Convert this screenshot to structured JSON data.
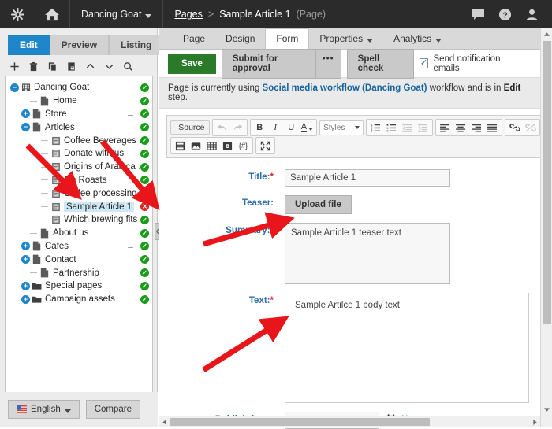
{
  "topbar": {
    "logo_icon": "kentico-asterisk-icon",
    "home_icon": "home-icon",
    "site_name": "Dancing Goat",
    "breadcrumb": {
      "root": "Pages",
      "separator": ">",
      "current": "Sample Article 1",
      "type": "(Page)"
    },
    "right_icons": [
      "chat-icon",
      "help-icon",
      "user-icon"
    ]
  },
  "sidebar": {
    "tabs": [
      {
        "label": "Edit",
        "active": true
      },
      {
        "label": "Preview",
        "active": false
      },
      {
        "label": "Listing",
        "active": false
      }
    ],
    "toolbar": [
      {
        "name": "new-page-button",
        "glyph": "+"
      },
      {
        "name": "delete-page-button",
        "glyph": "trash"
      },
      {
        "name": "copy-page-button",
        "glyph": "copy"
      },
      {
        "name": "paste-page-button",
        "glyph": "paste"
      },
      {
        "name": "move-up-button",
        "glyph": "chevron-up"
      },
      {
        "name": "move-down-button",
        "glyph": "chevron-down"
      },
      {
        "name": "search-button",
        "glyph": "search"
      }
    ],
    "tree": [
      {
        "label": "Dancing Goat",
        "indent": 0,
        "expander": "minus",
        "icon": "site-icon",
        "status": "ok",
        "arrow": false,
        "selected": false
      },
      {
        "label": "Home",
        "indent": 1,
        "expander": "none",
        "icon": "page-icon",
        "status": "ok",
        "arrow": false,
        "selected": false
      },
      {
        "label": "Store",
        "indent": 1,
        "expander": "plus",
        "icon": "page-icon",
        "status": "ok",
        "arrow": true,
        "selected": false
      },
      {
        "label": "Articles",
        "indent": 1,
        "expander": "minus",
        "icon": "page-icon",
        "status": "ok",
        "arrow": false,
        "selected": false
      },
      {
        "label": "Coffee Beverages explained",
        "indent": 2,
        "expander": "none",
        "icon": "article-icon",
        "status": "ok",
        "arrow": false,
        "selected": false
      },
      {
        "label": "Donate with us",
        "indent": 2,
        "expander": "none",
        "icon": "article-icon",
        "status": "ok",
        "arrow": false,
        "selected": false
      },
      {
        "label": "Origins of Arabica Bourbon",
        "indent": 2,
        "expander": "none",
        "icon": "article-icon",
        "status": "ok",
        "arrow": false,
        "selected": false
      },
      {
        "label": "On Roasts",
        "indent": 2,
        "expander": "none",
        "icon": "article-icon",
        "status": "ok",
        "arrow": false,
        "selected": false
      },
      {
        "label": "Coffee processing techniques",
        "indent": 2,
        "expander": "none",
        "icon": "article-icon",
        "status": "ok",
        "arrow": false,
        "selected": false
      },
      {
        "label": "Sample Article 1",
        "indent": 2,
        "expander": "none",
        "icon": "article-icon",
        "status": "error",
        "arrow": false,
        "selected": true
      },
      {
        "label": "Which brewing fits you?",
        "indent": 2,
        "expander": "none",
        "icon": "article-icon",
        "status": "ok",
        "arrow": false,
        "selected": false
      },
      {
        "label": "About us",
        "indent": 1,
        "expander": "none",
        "icon": "page-icon",
        "status": "ok",
        "arrow": false,
        "selected": false
      },
      {
        "label": "Cafes",
        "indent": 1,
        "expander": "plus",
        "icon": "page-icon",
        "status": "ok",
        "arrow": true,
        "selected": false
      },
      {
        "label": "Contact",
        "indent": 1,
        "expander": "plus",
        "icon": "page-icon",
        "status": "ok",
        "arrow": false,
        "selected": false
      },
      {
        "label": "Partnership",
        "indent": 1,
        "expander": "none",
        "icon": "page-icon",
        "status": "ok",
        "arrow": false,
        "selected": false
      },
      {
        "label": "Special pages",
        "indent": 1,
        "expander": "plus",
        "icon": "folder-icon",
        "status": "ok",
        "arrow": false,
        "selected": false
      },
      {
        "label": "Campaign assets",
        "indent": 1,
        "expander": "plus",
        "icon": "folder-icon",
        "status": "ok",
        "arrow": false,
        "selected": false
      }
    ],
    "footer": {
      "language": "English",
      "language_flag": "us-flag-icon",
      "compare": "Compare"
    }
  },
  "content": {
    "tabs": [
      {
        "label": "Page",
        "active": false,
        "caret": false
      },
      {
        "label": "Design",
        "active": false,
        "caret": false
      },
      {
        "label": "Form",
        "active": true,
        "caret": false
      },
      {
        "label": "Properties",
        "active": false,
        "caret": true
      },
      {
        "label": "Analytics",
        "active": false,
        "caret": true
      }
    ],
    "actions": {
      "save": "Save",
      "submit": "Submit for approval",
      "more": "•••",
      "spell_check": "Spell check",
      "notify_label": "Send notification emails",
      "notify_checked": true
    },
    "workflow": {
      "prefix": "Page is currently using ",
      "name": "Social media workflow (Dancing Goat)",
      "middle": " workflow and is in ",
      "step": "Edit",
      "suffix": " step."
    },
    "editor_toolbar": {
      "source_label": "Source",
      "styles_label": "Styles",
      "row1": [
        "undo-icon",
        "redo-icon",
        "bold-icon",
        "italic-icon",
        "underline-icon",
        "text-color-icon",
        "numbered-list-icon",
        "bulleted-list-icon",
        "outdent-icon",
        "indent-icon",
        "align-left-icon",
        "align-center-icon",
        "align-right-icon",
        "justify-icon",
        "link-icon",
        "unlink-icon"
      ],
      "row2": [
        "page-break-icon",
        "image-icon",
        "table-icon",
        "media-icon",
        "macro-icon",
        "maximize-icon"
      ]
    },
    "form": {
      "title": {
        "label": "Title:",
        "required": true,
        "value": "Sample Article 1"
      },
      "teaser": {
        "label": "Teaser:",
        "required": false,
        "button": "Upload file"
      },
      "summary": {
        "label": "Summary:",
        "required": true,
        "value": "Sample Article 1 teaser text"
      },
      "text": {
        "label": "Text:",
        "required": true,
        "value": "Sample Artilce 1 body text"
      },
      "publish_from": {
        "label": "Publish from:",
        "required": false,
        "value": "",
        "calendar_icon": "calendar-icon",
        "now_link": "Now"
      }
    }
  },
  "colors": {
    "topbar_bg": "#2b2b2b",
    "accent_blue": "#1f87c9",
    "save_green": "#2a7a2a",
    "status_ok": "#1a9c1a",
    "status_error": "#d4281f",
    "label_blue": "#2e6da4",
    "arrow_red": "#e8161a"
  }
}
